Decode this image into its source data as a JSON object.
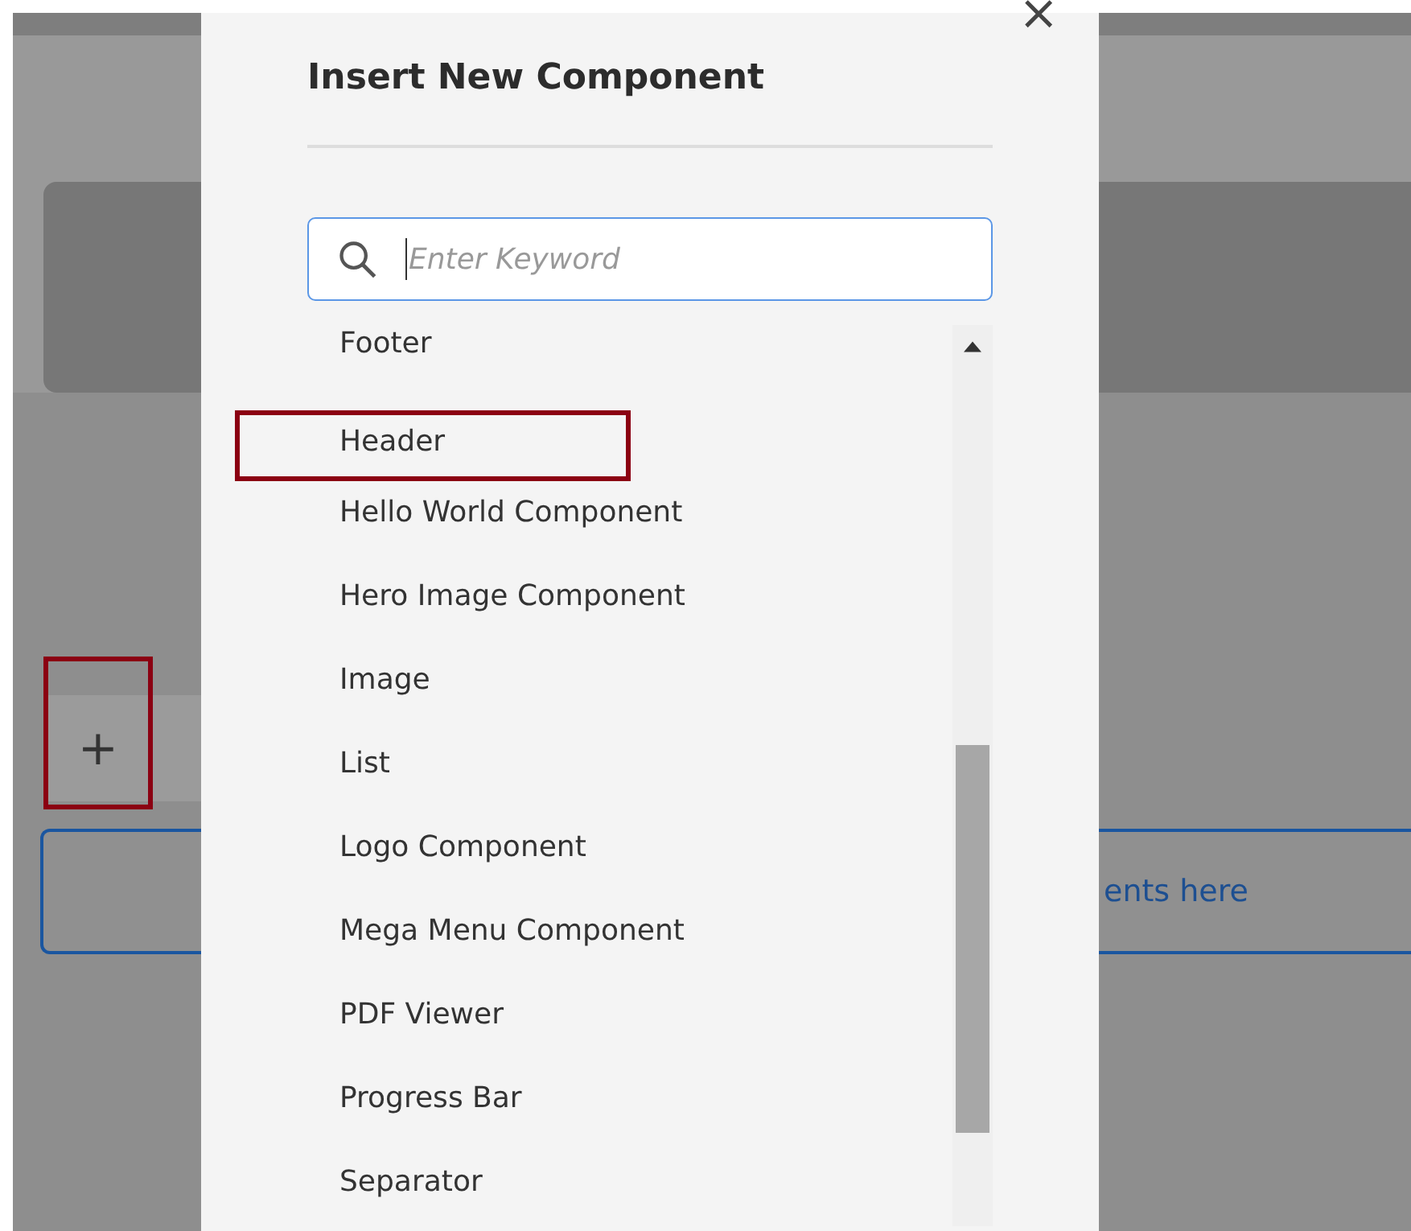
{
  "background": {
    "toolbar": {
      "add_button": {
        "label": "+",
        "highlighted": true
      }
    },
    "drop_zone": {
      "text": "ents here"
    }
  },
  "dialog": {
    "title": "Insert New Component",
    "close": "×",
    "search": {
      "placeholder": "Enter Keyword"
    },
    "items": [
      {
        "label": "Footer",
        "highlighted": false
      },
      {
        "label": "Header",
        "highlighted": true
      },
      {
        "label": "Hello World Component",
        "highlighted": false
      },
      {
        "label": "Hero Image Component",
        "highlighted": false
      },
      {
        "label": "Image",
        "highlighted": false
      },
      {
        "label": "List",
        "highlighted": false
      },
      {
        "label": "Logo Component",
        "highlighted": false
      },
      {
        "label": "Mega Menu Component",
        "highlighted": false
      },
      {
        "label": "PDF Viewer",
        "highlighted": false
      },
      {
        "label": "Progress Bar",
        "highlighted": false
      },
      {
        "label": "Separator",
        "highlighted": false
      }
    ]
  }
}
